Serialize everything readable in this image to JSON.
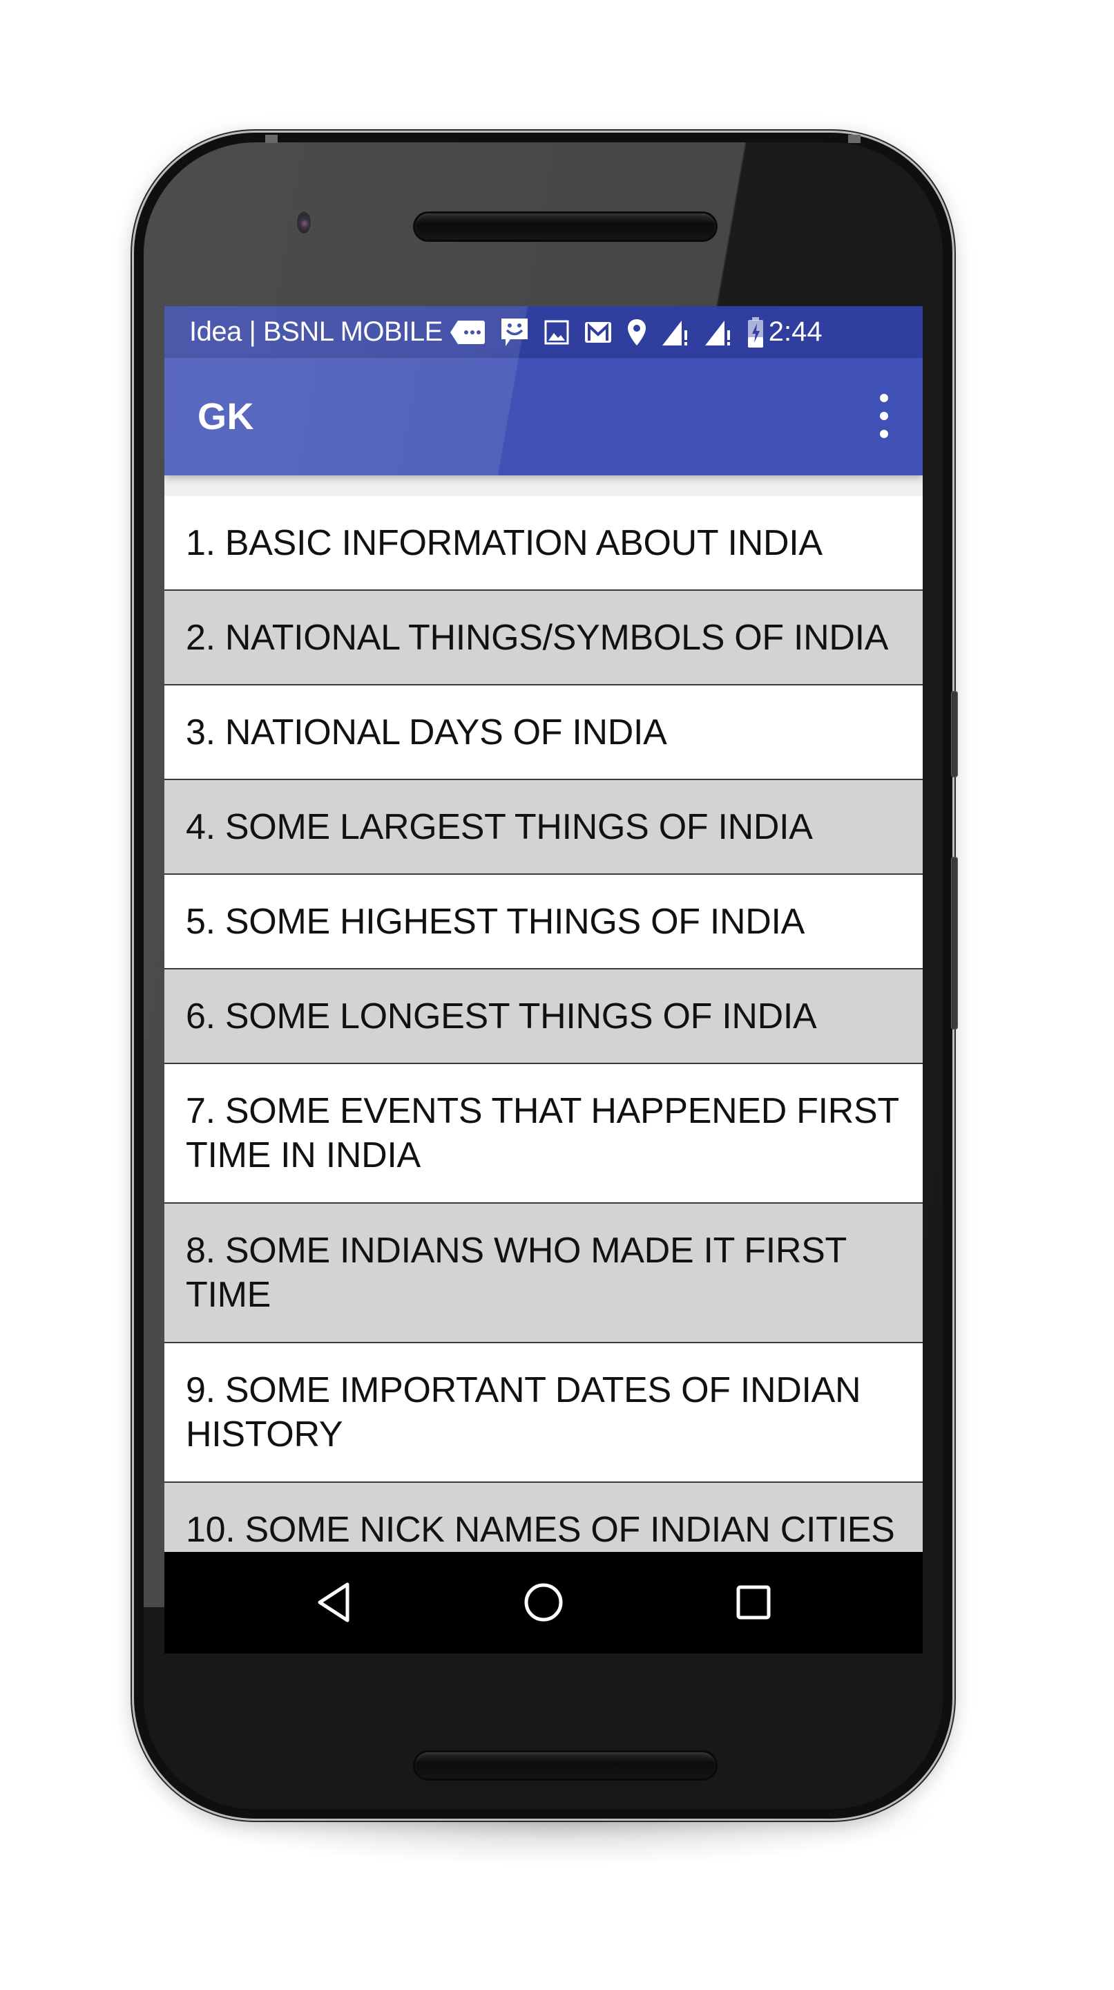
{
  "status_bar": {
    "carrier": "Idea | BSNL MOBILE",
    "icons": [
      "sms-icon",
      "messenger-icon",
      "image-icon",
      "gmail-icon",
      "location-icon",
      "signal-sim1-icon",
      "signal-sim2-icon",
      "battery-charging-icon"
    ],
    "time": "2:44"
  },
  "app_bar": {
    "title": "GK",
    "overflow_icon": "more-vert-icon"
  },
  "list": {
    "items": [
      {
        "label": "1. BASIC INFORMATION ABOUT INDIA"
      },
      {
        "label": "2. NATIONAL THINGS/SYMBOLS OF INDIA"
      },
      {
        "label": "3. NATIONAL DAYS OF INDIA"
      },
      {
        "label": "4. SOME LARGEST THINGS OF INDIA"
      },
      {
        "label": "5. SOME HIGHEST THINGS OF INDIA"
      },
      {
        "label": "6. SOME LONGEST THINGS OF INDIA"
      },
      {
        "label": "7. SOME EVENTS THAT HAPPENED FIRST TIME IN INDIA"
      },
      {
        "label": "8. SOME INDIANS WHO MADE IT FIRST TIME"
      },
      {
        "label": "9. SOME IMPORTANT DATES OF INDIAN HISTORY"
      },
      {
        "label": "10. SOME NICK NAMES OF INDIAN CITIES"
      }
    ]
  },
  "nav_bar": {
    "buttons": [
      "back-icon",
      "home-icon",
      "recents-icon"
    ]
  },
  "colors": {
    "primary": "#3f51b5",
    "primary_dark": "#303f9f",
    "row_alt": "#d3d3d3",
    "row": "#ffffff"
  }
}
